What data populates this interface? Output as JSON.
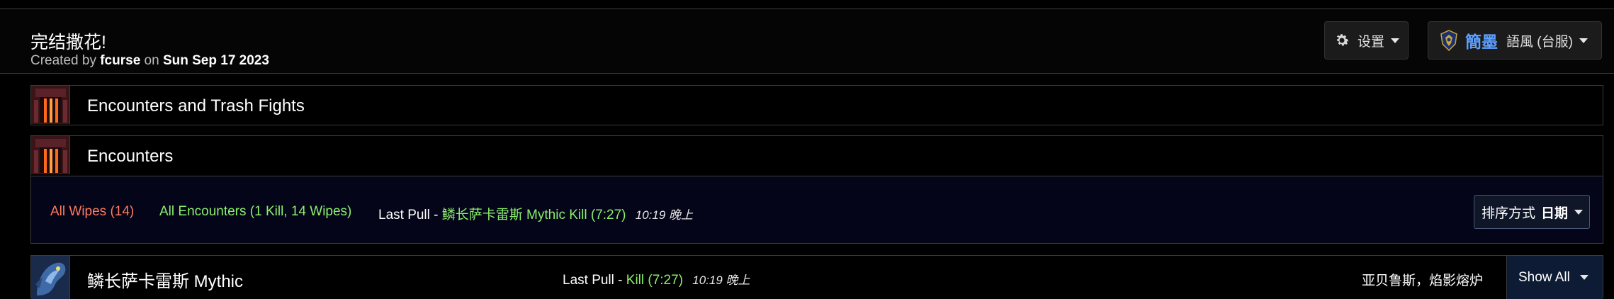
{
  "report": {
    "title": "完结撒花!",
    "created_prefix": "Created by",
    "author": "fcurse",
    "on_word": "on",
    "date": "Sun Sep 17 2023"
  },
  "toolbar": {
    "settings_label": "设置",
    "guild_name": "簡墨",
    "guild_server": "語風 (台服)"
  },
  "panels": {
    "encounters_and_trash": "Encounters and Trash Fights",
    "encounters": "Encounters"
  },
  "filters": {
    "all_wipes": "All Wipes (14)",
    "all_encounters": "All Encounters (1 Kill, 14 Wipes)",
    "last_pull_label": "Last Pull -",
    "last_pull_value": "鳞长萨卡雷斯 Mythic Kill (7:27)",
    "last_pull_time": "10:19 晚上"
  },
  "sort": {
    "label": "排序方式",
    "value": "日期"
  },
  "boss_row": {
    "name": "鳞长萨卡雷斯 Mythic",
    "last_pull_label": "Last Pull -",
    "last_pull_value": "Kill (7:27)",
    "last_pull_time": "10:19 晚上",
    "zone": "亚贝鲁斯，焰影熔炉",
    "show_all": "Show All"
  },
  "colors": {
    "wipes": "#ff7a5c",
    "kill": "#8af06a",
    "guild": "#5fa0ff"
  }
}
